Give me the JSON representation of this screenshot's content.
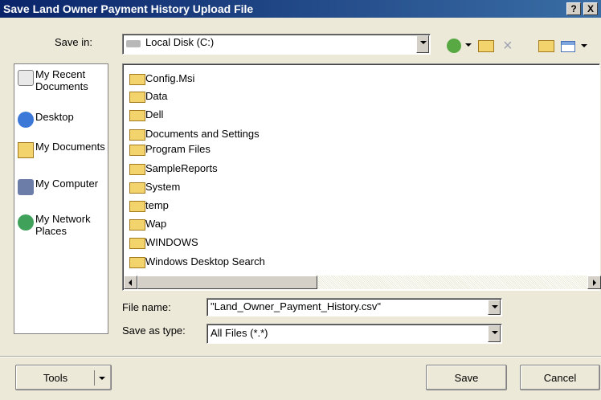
{
  "window": {
    "title": "Save Land Owner Payment History Upload File",
    "help_label": "?",
    "close_label": "X"
  },
  "save_in": {
    "label": "Save in:",
    "value": "Local Disk (C:)"
  },
  "places": [
    {
      "label": "My Recent Documents",
      "icon": "recent-documents-icon"
    },
    {
      "label": "Desktop",
      "icon": "desktop-icon"
    },
    {
      "label": "My Documents",
      "icon": "my-documents-icon"
    },
    {
      "label": "My Computer",
      "icon": "computer-icon"
    },
    {
      "label": "My Network Places",
      "icon": "network-places-icon"
    }
  ],
  "files": [
    "Config.Msi",
    "Data",
    "Dell",
    "Documents and Settings",
    "Program Files",
    "SampleReports",
    "System",
    "temp",
    "Wap",
    "WINDOWS",
    "Windows Desktop Search"
  ],
  "file_name": {
    "label": "File name:",
    "value": "\"Land_Owner_Payment_History.csv\""
  },
  "save_as_type": {
    "label": "Save as type:",
    "value": "All Files (*.*)"
  },
  "buttons": {
    "tools": "Tools",
    "save": "Save",
    "cancel": "Cancel"
  },
  "colors": {
    "title_start": "#0a246a",
    "title_end": "#3a6ea5",
    "folder": "#f3d36b",
    "dialog_bg": "#ece9d8"
  }
}
